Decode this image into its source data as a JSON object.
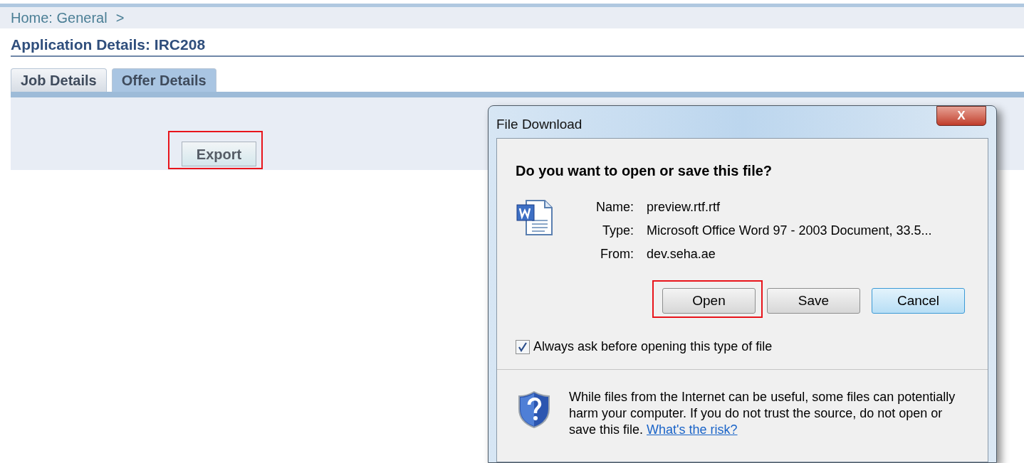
{
  "breadcrumb": {
    "text": "Home: General",
    "separator": ">"
  },
  "page_title": "Application Details: IRC208",
  "tabs": [
    {
      "label": "Job Details",
      "selected": false
    },
    {
      "label": "Offer Details",
      "selected": true
    }
  ],
  "export_button": {
    "label": "Export",
    "highlighted": true
  },
  "dialog": {
    "title": "File Download",
    "close": "X",
    "question": "Do you want to open or save this file?",
    "fields": [
      {
        "label": "Name:",
        "value": "preview.rtf.rtf"
      },
      {
        "label": "Type:",
        "value": "Microsoft Office Word 97 - 2003 Document, 33.5..."
      },
      {
        "label": "From:",
        "value": "dev.seha.ae"
      }
    ],
    "buttons": [
      {
        "label": "Open",
        "highlighted": true,
        "default": false
      },
      {
        "label": "Save",
        "highlighted": false,
        "default": false
      },
      {
        "label": "Cancel",
        "highlighted": false,
        "default": true
      }
    ],
    "always_ask": {
      "label": "Always ask before opening this type of file",
      "checked": true
    },
    "warning": {
      "text": "While files from the Internet can be useful, some files can potentially harm your computer. If you do not trust the source, do not open or save this file.",
      "link": "What's the risk?"
    }
  }
}
